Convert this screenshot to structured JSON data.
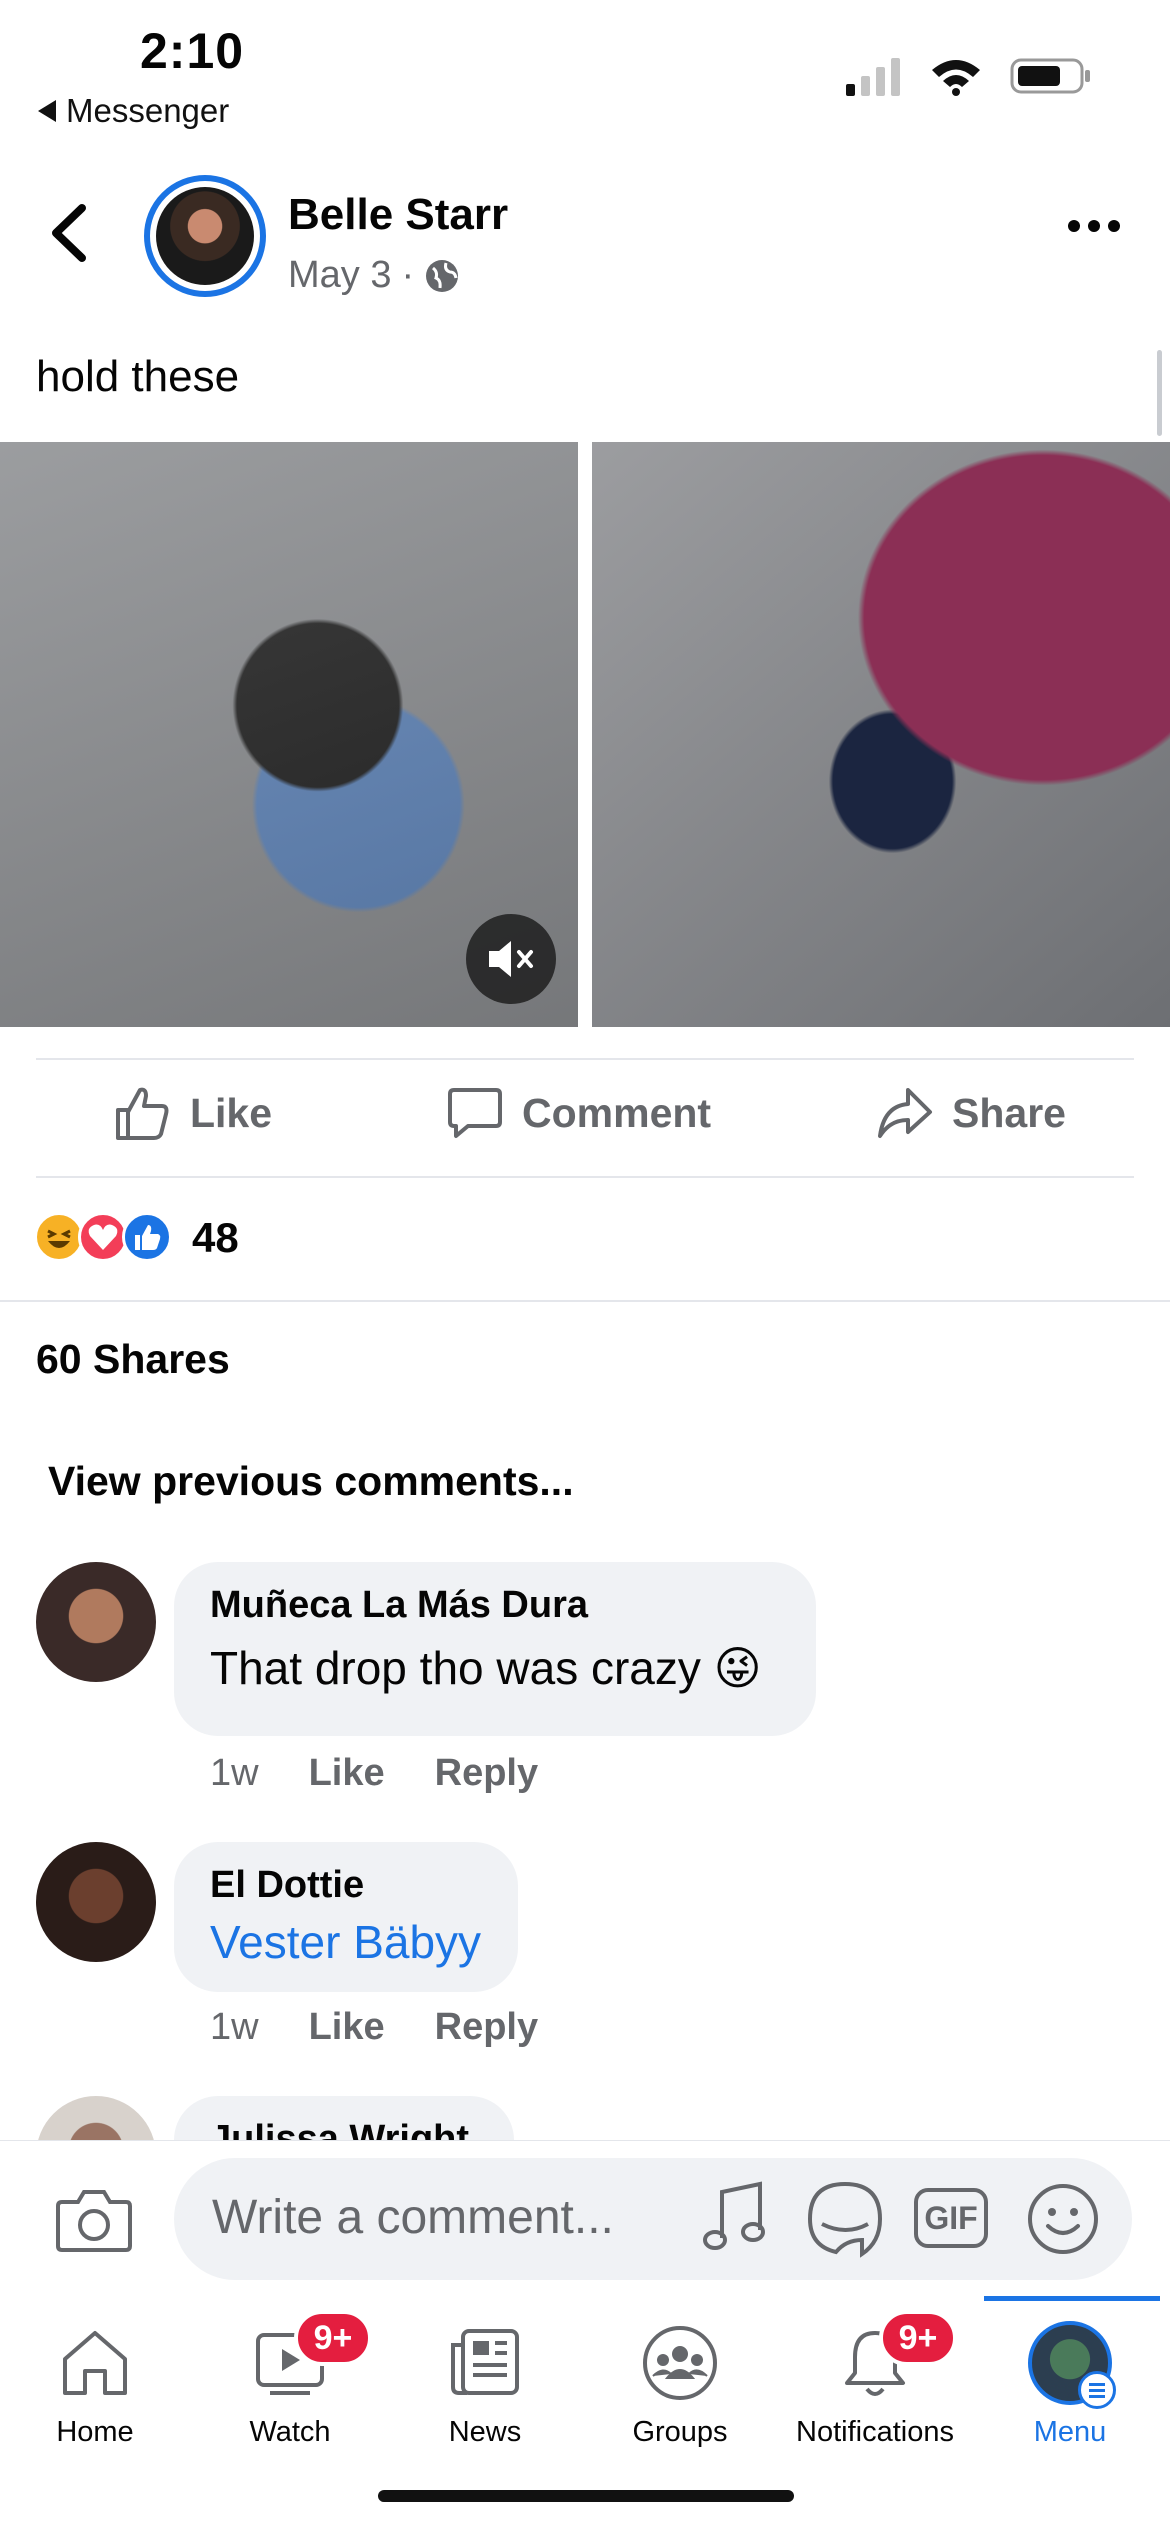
{
  "status_bar": {
    "time": "2:10",
    "back_app": "Messenger"
  },
  "post": {
    "author": "Belle Starr",
    "date": "May 3",
    "privacy_icon": "globe-icon",
    "text": "hold these"
  },
  "actions": {
    "like": "Like",
    "comment": "Comment",
    "share": "Share"
  },
  "reactions": {
    "types": [
      "haha",
      "love",
      "like"
    ],
    "count": "48"
  },
  "shares": "60 Shares",
  "view_previous": "View previous comments...",
  "comments": [
    {
      "author": "Muñeca La Más Dura",
      "text": "That drop tho was crazy 😜",
      "time": "1w",
      "like": "Like",
      "reply": "Reply"
    },
    {
      "author": "El Dottie",
      "text": "Vester Bäbyy",
      "time": "1w",
      "like": "Like",
      "reply": "Reply"
    },
    {
      "author": "Julissa Wright"
    }
  ],
  "composer": {
    "placeholder": "Write a comment...",
    "gif": "GIF"
  },
  "tabs": [
    {
      "label": "Home"
    },
    {
      "label": "Watch",
      "badge": "9+"
    },
    {
      "label": "News"
    },
    {
      "label": "Groups"
    },
    {
      "label": "Notifications",
      "badge": "9+"
    },
    {
      "label": "Menu",
      "active": true
    }
  ],
  "colors": {
    "accent": "#1b74e4",
    "badge": "#e41e3f",
    "secondary_text": "#65676b",
    "bubble": "#f0f2f5"
  }
}
